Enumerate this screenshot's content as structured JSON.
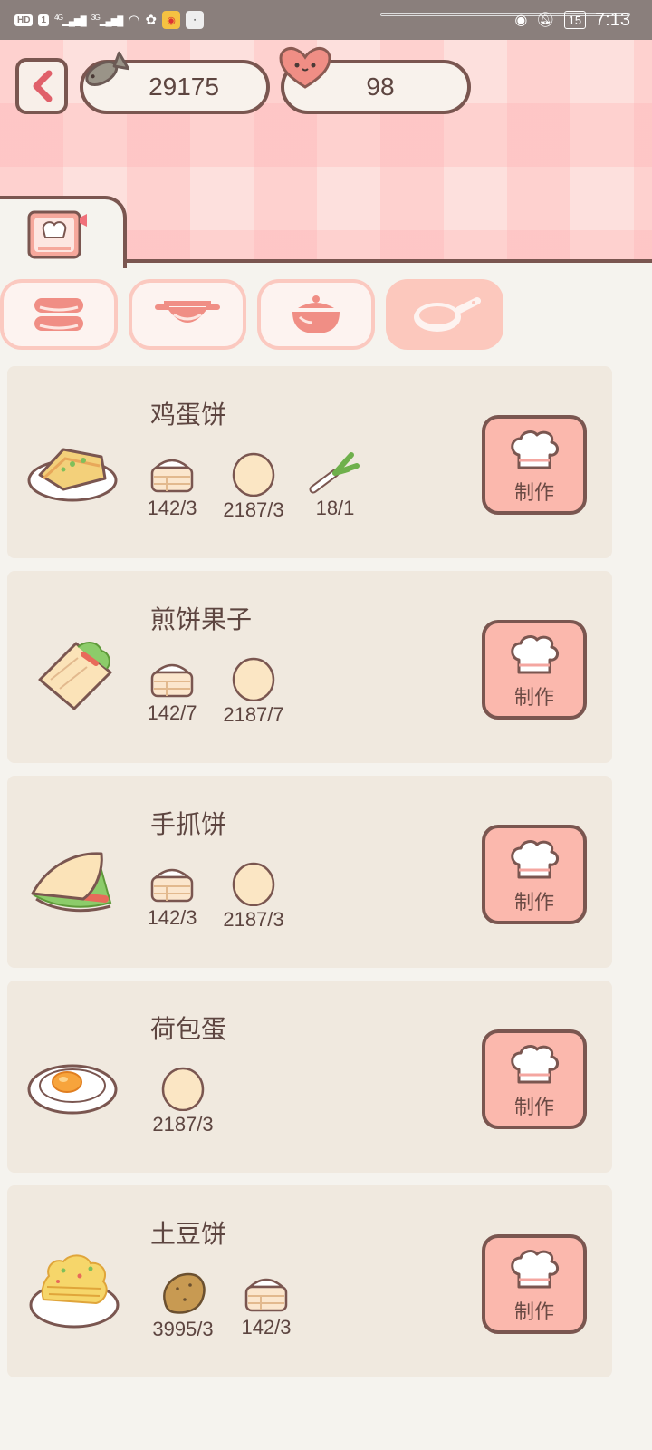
{
  "status_bar": {
    "left_chips": [
      "HD",
      "1"
    ],
    "net1": "4G",
    "net2": "3G",
    "battery": "15",
    "time": "7:13"
  },
  "header": {
    "fish_count": "29175",
    "heart_count": "98"
  },
  "make_label": "制作",
  "recipes": [
    {
      "name": "鸡蛋饼",
      "ingredients": [
        {
          "icon": "flour-icon",
          "qty": "142/3"
        },
        {
          "icon": "egg-icon",
          "qty": "2187/3"
        },
        {
          "icon": "scallion-icon",
          "qty": "18/1"
        }
      ]
    },
    {
      "name": "煎饼果子",
      "ingredients": [
        {
          "icon": "flour-icon",
          "qty": "142/7"
        },
        {
          "icon": "egg-icon",
          "qty": "2187/7"
        }
      ]
    },
    {
      "name": "手抓饼",
      "ingredients": [
        {
          "icon": "flour-icon",
          "qty": "142/3"
        },
        {
          "icon": "egg-icon",
          "qty": "2187/3"
        }
      ]
    },
    {
      "name": "荷包蛋",
      "ingredients": [
        {
          "icon": "egg-icon",
          "qty": "2187/3"
        }
      ]
    },
    {
      "name": "土豆饼",
      "ingredients": [
        {
          "icon": "potato-icon",
          "qty": "3995/3"
        },
        {
          "icon": "flour-icon",
          "qty": "142/3"
        }
      ]
    }
  ],
  "colors": {
    "outline": "#7a5650",
    "accent_pink": "#fbb8ad",
    "card_bg": "#f0e9df",
    "page_bg": "#f5f3ee"
  }
}
